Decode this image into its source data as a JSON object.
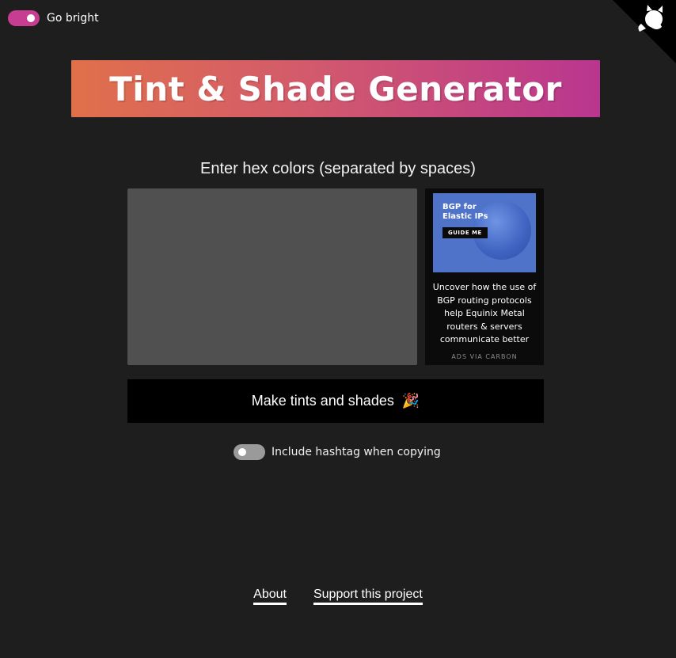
{
  "theme_toggle": {
    "label": "Go bright",
    "state": "on"
  },
  "corner": {
    "icon": "github-octocat-icon"
  },
  "header": {
    "title": "Tint & Shade Generator"
  },
  "form": {
    "prompt": "Enter hex colors (separated by spaces)",
    "input_value": "",
    "submit_label": "Make tints and shades",
    "submit_emoji": "🎉"
  },
  "ad": {
    "image_headline": "BGP for Elastic IPs",
    "image_cta": "GUIDE ME",
    "text": "Uncover how the use of BGP routing protocols help Equinix Metal routers & servers communicate better",
    "via": "ADS VIA CARBON"
  },
  "hashtag_toggle": {
    "label": "Include hashtag when copying",
    "state": "off"
  },
  "footer": {
    "links": [
      "About",
      "Support this project"
    ]
  },
  "colors": {
    "background": "#1e1e1e",
    "accent": "#c63d92",
    "banner_start": "#e0704b",
    "banner_end": "#b9368f",
    "input_bg": "#505050",
    "button_bg": "#000000"
  }
}
